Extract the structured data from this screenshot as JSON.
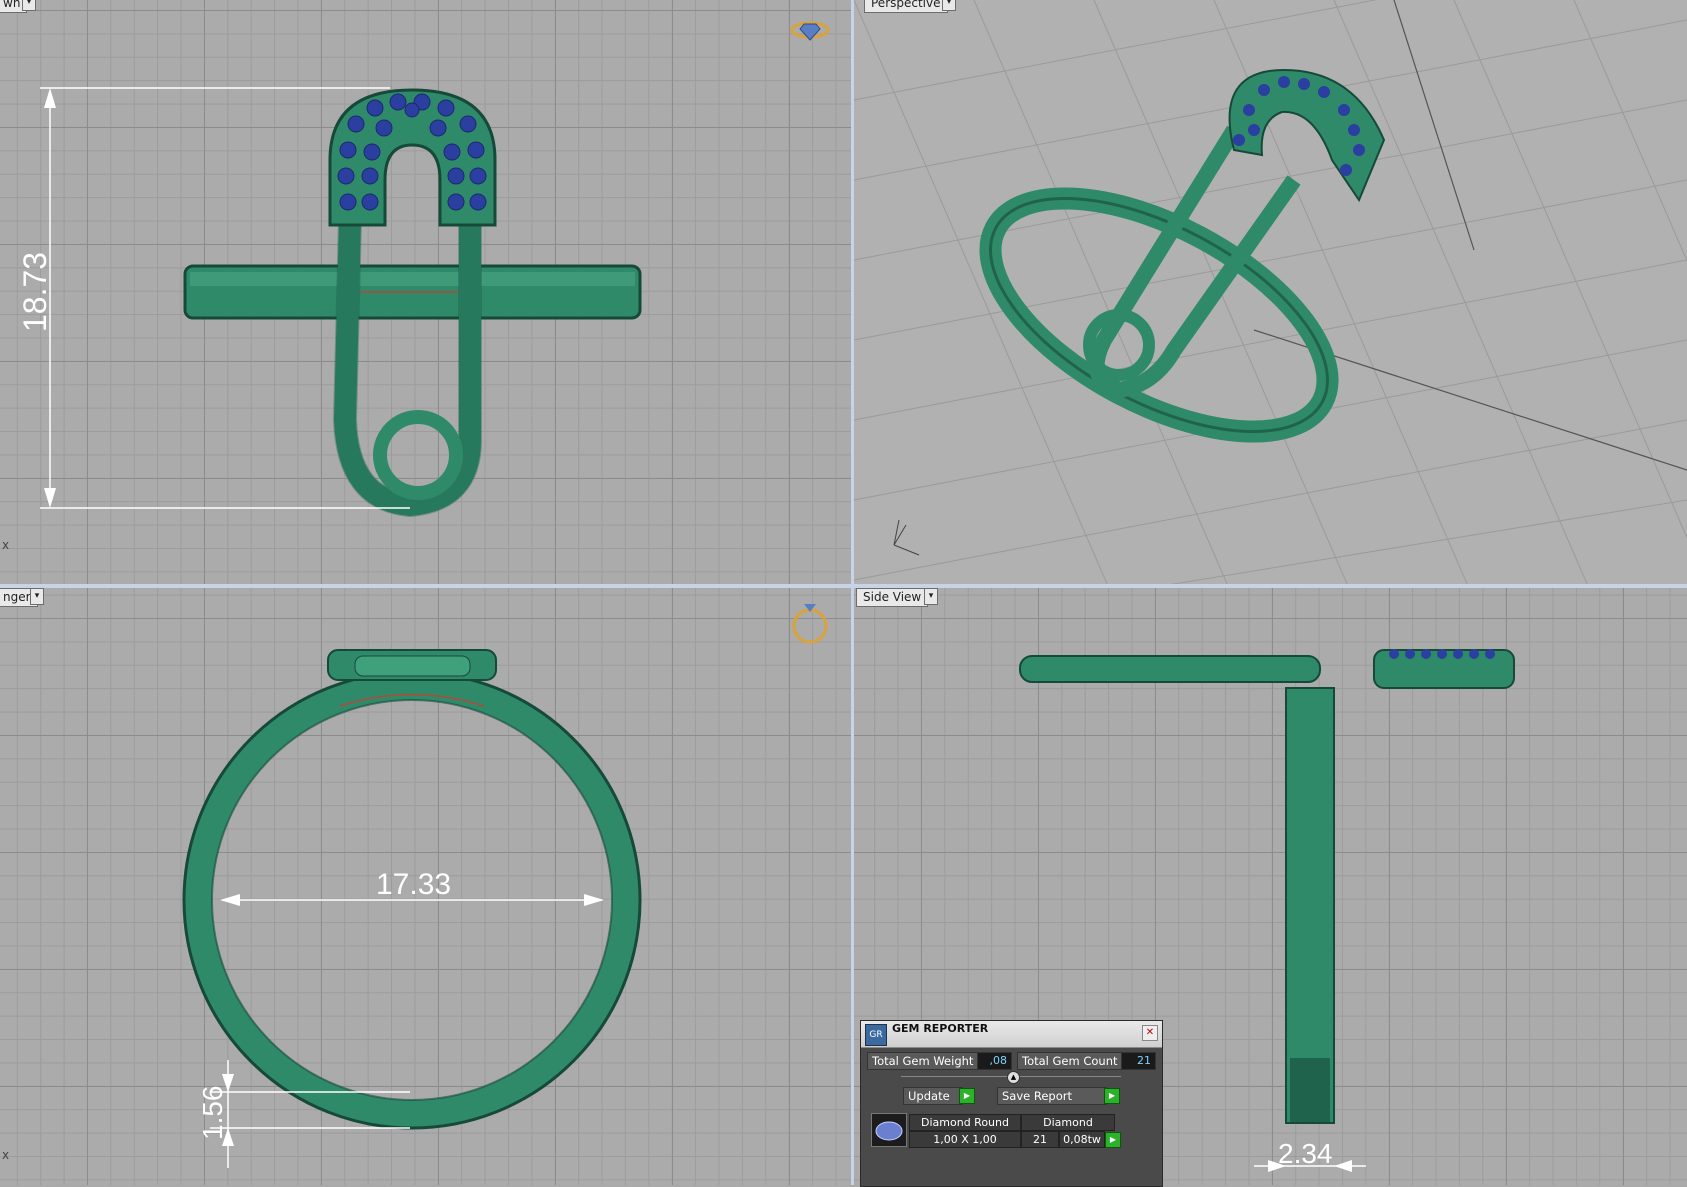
{
  "viewports": {
    "top": {
      "label": "wn",
      "axis_x": "x"
    },
    "perspective": {
      "label": "Perspective"
    },
    "front": {
      "label": "nger",
      "axis_x": "x"
    },
    "side": {
      "label": "Side View"
    }
  },
  "dimensions": {
    "top_height": "18.73",
    "front_inner_diameter": "17.33",
    "front_band_thickness": "1.56",
    "side_band_width": "2.34"
  },
  "colors": {
    "metal": "#2f8a6a",
    "metal_dark": "#1b5a44",
    "gem": "#2a3fa0",
    "grid_major": "#8c8c8c",
    "viewport_bg": "#ababab",
    "dimension_line": "#ffffff",
    "active_border": "#c8d3e6"
  },
  "gem_reporter": {
    "title": "GEM REPORTER",
    "total_weight_label": "Total Gem Weight",
    "total_weight_value": ",08",
    "total_count_label": "Total Gem Count",
    "total_count_value": "21",
    "update_label": "Update",
    "save_label": "Save Report",
    "table": {
      "shape_header": "Diamond Round",
      "material_header": "Diamond",
      "size": "1,00 X 1,00",
      "count": "21",
      "weight": "0,08tw"
    }
  }
}
